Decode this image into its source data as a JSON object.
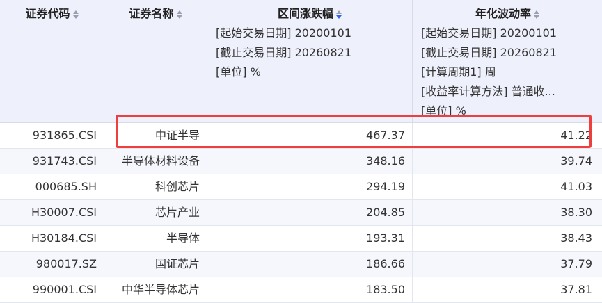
{
  "columns": [
    {
      "title": "证券代码",
      "params": []
    },
    {
      "title": "证券名称",
      "params": []
    },
    {
      "title": "区间涨跌幅",
      "params": [
        "[起始交易日期] 20200101",
        "[截止交易日期] 20260821",
        "[单位] %"
      ]
    },
    {
      "title": "年化波动率",
      "params": [
        "[起始交易日期] 20200101",
        "[截止交易日期] 20260821",
        "[计算周期1] 周",
        "[收益率计算方法] 普通收...",
        "[单位] %"
      ]
    }
  ],
  "rows": [
    {
      "code": "931865.CSI",
      "name": "中证半导",
      "change": "467.37",
      "volatility": "41.22"
    },
    {
      "code": "931743.CSI",
      "name": "半导体材料设备",
      "change": "348.16",
      "volatility": "39.74"
    },
    {
      "code": "000685.SH",
      "name": "科创芯片",
      "change": "294.19",
      "volatility": "41.03"
    },
    {
      "code": "H30007.CSI",
      "name": "芯片产业",
      "change": "204.85",
      "volatility": "38.30"
    },
    {
      "code": "H30184.CSI",
      "name": "半导体",
      "change": "193.31",
      "volatility": "38.43"
    },
    {
      "code": "980017.SZ",
      "name": "国证芯片",
      "change": "186.66",
      "volatility": "37.79"
    },
    {
      "code": "990001.CSI",
      "name": "中华半导体芯片",
      "change": "183.50",
      "volatility": "37.81"
    }
  ],
  "sort": {
    "active_column": "区间涨跌幅",
    "direction": "descending"
  },
  "colors": {
    "header_bg": "#eef0fb",
    "highlight": "#ef3e3e",
    "sort_active": "#2d63e6"
  }
}
